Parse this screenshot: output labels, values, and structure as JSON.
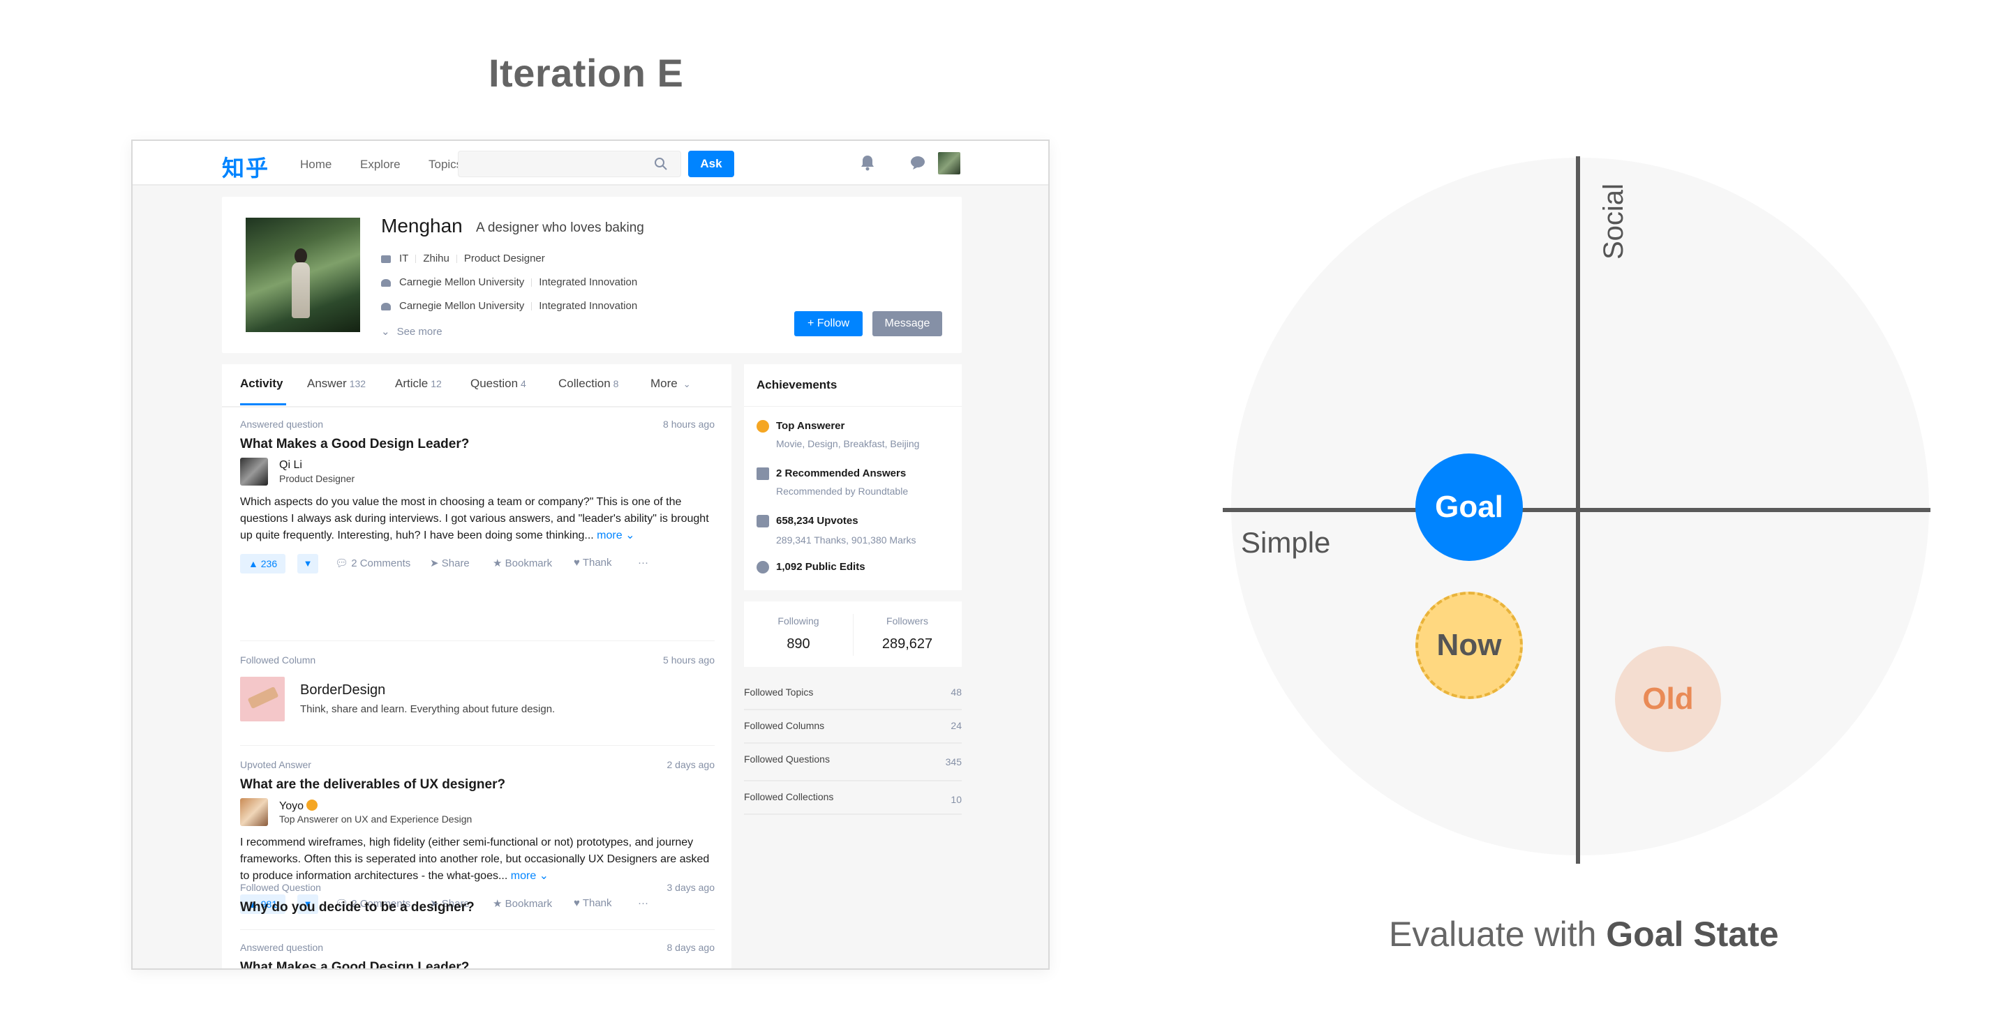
{
  "slide_title": "Iteration E",
  "app": {
    "logo": "知乎",
    "nav": [
      "Home",
      "Explore",
      "Topics"
    ],
    "search_placeholder": "",
    "ask_label": "Ask"
  },
  "profile": {
    "name": "Menghan",
    "bio": "A designer who loves baking",
    "work": [
      "IT",
      "Zhihu",
      "Product Designer"
    ],
    "edu1": [
      "Carnegie Mellon University",
      "Integrated Innovation"
    ],
    "edu2": [
      "Carnegie Mellon University",
      "Integrated Innovation"
    ],
    "see_more": "See more",
    "follow_label": "+ Follow",
    "message_label": "Message"
  },
  "tabs": [
    {
      "label": "Activity",
      "count": ""
    },
    {
      "label": "Answer",
      "count": "132"
    },
    {
      "label": "Article",
      "count": "12"
    },
    {
      "label": "Question",
      "count": "4"
    },
    {
      "label": "Collection",
      "count": "8"
    },
    {
      "label": "More",
      "count": ""
    }
  ],
  "feed": [
    {
      "type": "Answered question",
      "time": "8 hours ago",
      "title": "What Makes a Good Design Leader?",
      "author": "Qi Li",
      "headline": "Product Designer",
      "body": "Which aspects do you value the most in choosing a team or company?\" This is one of the questions I always ask during interviews. I got various answers, and \"leader's ability\" is brought up quite frequently. Interesting, huh? I have been doing some thinking...",
      "more": "more",
      "votes": "▲ 236",
      "comments": "2 Comments",
      "share": "Share",
      "bookmark": "Bookmark",
      "thank": "Thank"
    },
    {
      "type": "Followed Column",
      "time": "5 hours ago",
      "column_name": "BorderDesign",
      "column_desc": "Think, share and learn. Everything about future design."
    },
    {
      "type": "Upvoted Answer",
      "time": "2 days ago",
      "title": "What are the deliverables of UX designer?",
      "author": "Yoyo",
      "headline": "Top Answerer on UX and Experience Design",
      "body": "I recommend wireframes, high fidelity (either semi-functional or not) prototypes, and journey frameworks. Often this is seperated into another role, but occasionally UX Designers are asked to produce information architectures - the what-goes...",
      "more": "more",
      "votes": "▲ 981",
      "comments": "2 Comments",
      "share": "Share",
      "bookmark": "Bookmark",
      "thank": "Thank"
    },
    {
      "type": "Followed Question",
      "time": "3 days ago",
      "title": "Why do you decide to be a designer?"
    },
    {
      "type": "Answered question",
      "time": "8 days ago",
      "title": "What Makes a Good Design Leader?"
    }
  ],
  "achievements": {
    "title": "Achievements",
    "items": [
      {
        "main": "Top Answerer",
        "sub": "Movie, Design, Breakfast, Beijing",
        "icon": "star-badge-icon"
      },
      {
        "main": "2 Recommended Answers",
        "sub": "Recommended by Roundtable",
        "icon": "bookmark-icon"
      },
      {
        "main": "658,234 Upvotes",
        "sub": "289,341 Thanks, 901,380 Marks",
        "icon": "thumbs-up-icon"
      },
      {
        "main": "1,092 Public Edits",
        "sub": "",
        "icon": "edit-icon"
      }
    ]
  },
  "follow_stats": {
    "following_label": "Following",
    "following_value": "890",
    "followers_label": "Followers",
    "followers_value": "289,627"
  },
  "followed": [
    {
      "label": "Followed Topics",
      "count": "48"
    },
    {
      "label": "Followed Columns",
      "count": "24"
    },
    {
      "label": "Followed Questions",
      "count": "345"
    },
    {
      "label": "Followed Collections",
      "count": "10"
    }
  ],
  "diagram": {
    "axis_y_label": "Social",
    "axis_x_label": "Simple",
    "goal": "Goal",
    "now": "Now",
    "old": "Old",
    "caption_prefix": "Evaluate with ",
    "caption_bold": "Goal State",
    "colors": {
      "goal": "#0084ff",
      "now": "#ffd880",
      "old": "#f4ddd0"
    }
  }
}
